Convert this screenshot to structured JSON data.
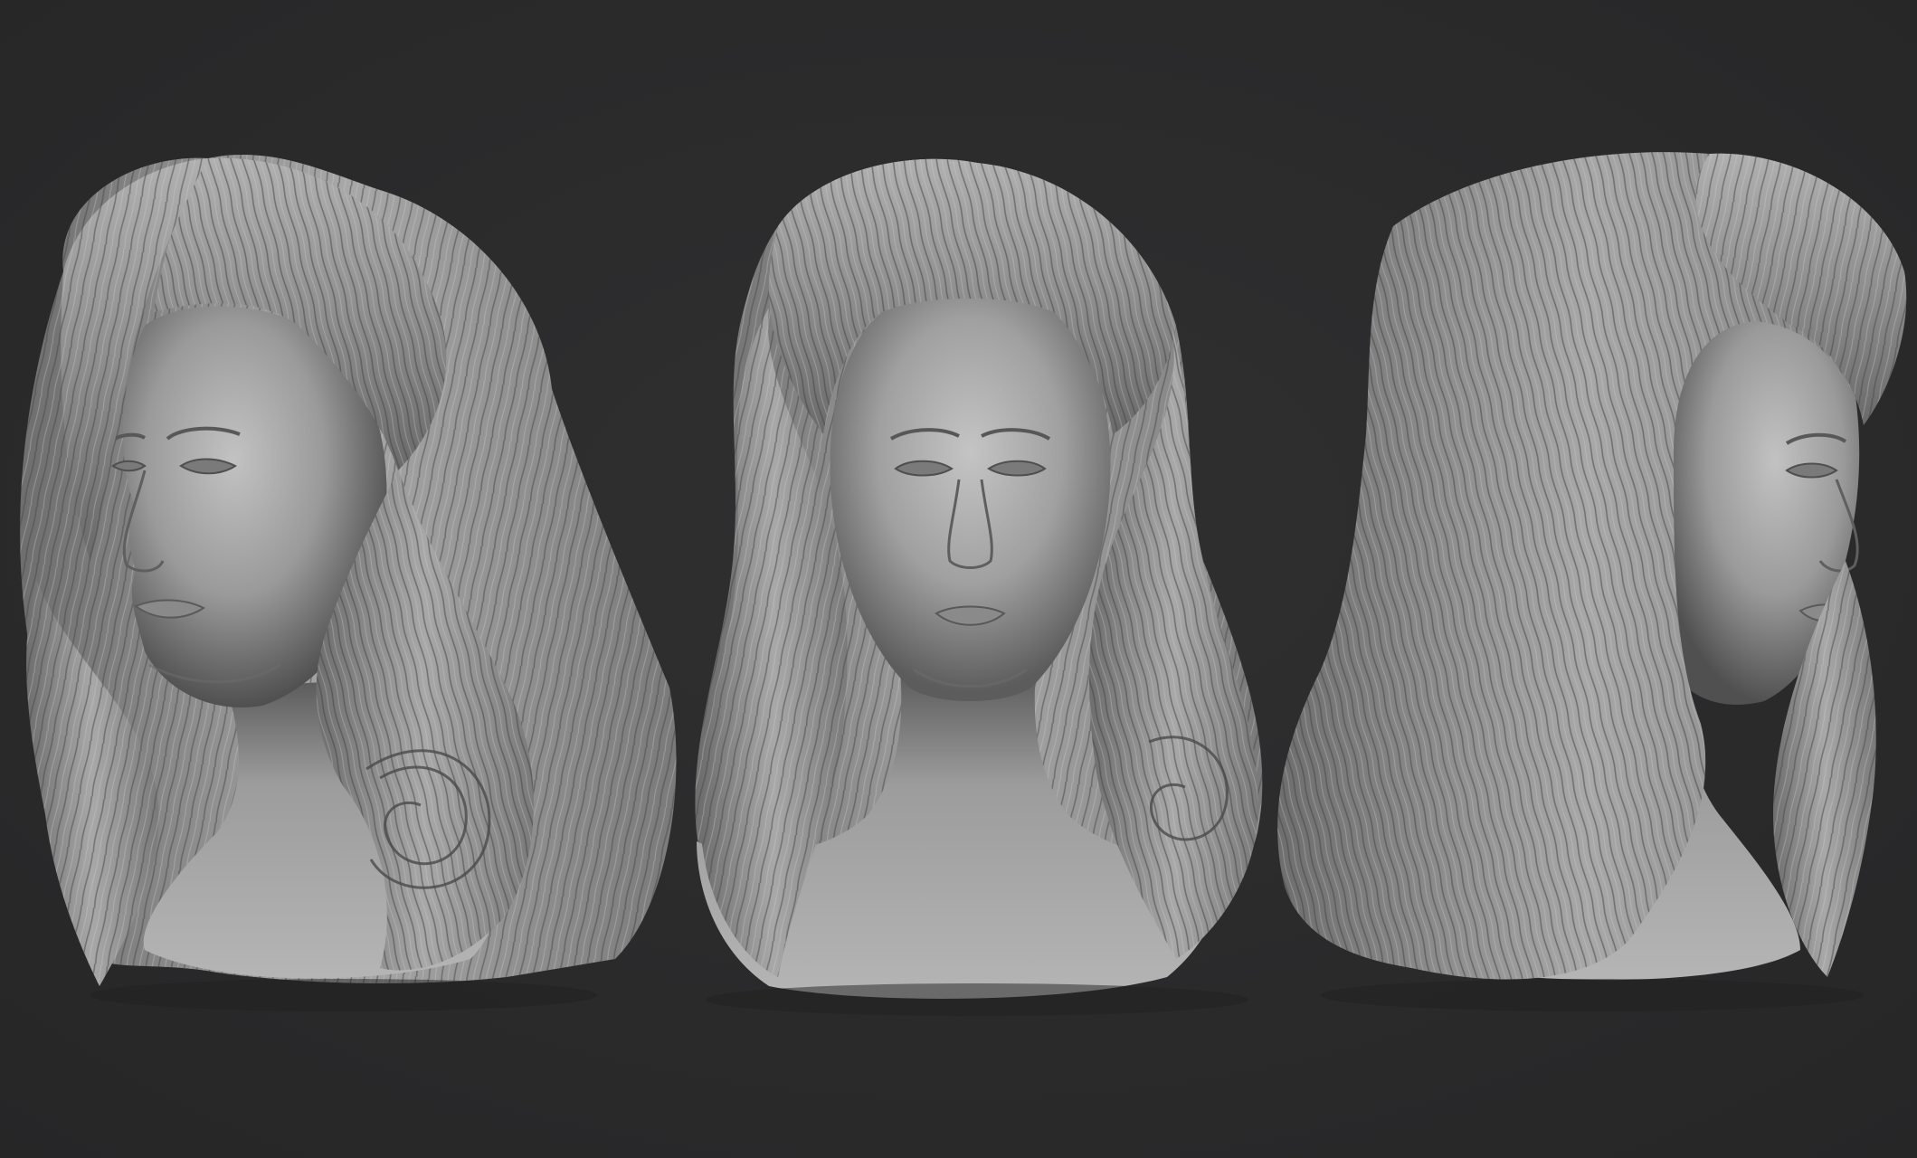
{
  "scene": {
    "background_color": "#2b2b2c",
    "clay_light": "#b9b9b9",
    "clay_mid": "#8a8a8a",
    "clay_dark": "#3c3c3c",
    "hair_stroke": "#4a4a4a"
  },
  "views": [
    {
      "name": "three-quarter-left"
    },
    {
      "name": "front"
    },
    {
      "name": "three-quarter-right"
    }
  ]
}
